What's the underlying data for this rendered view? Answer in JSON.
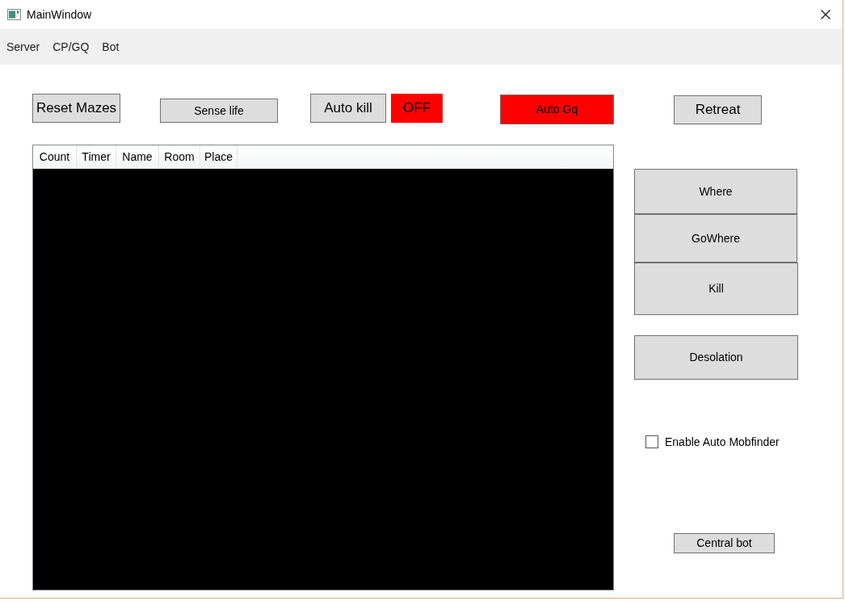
{
  "window": {
    "title": "MainWindow"
  },
  "menu": [
    "Server",
    "CP/GQ",
    "Bot"
  ],
  "toolbar": [
    {
      "kind": "button",
      "label": "Reset Mazes"
    },
    {
      "kind": "button",
      "label": "Sense life"
    },
    {
      "kind": "button",
      "label": "Auto kill"
    },
    {
      "kind": "status",
      "label": "OFF",
      "on": false
    },
    {
      "kind": "toggle",
      "label": "Auto Gq",
      "on": false
    },
    {
      "kind": "button",
      "label": "Retreat"
    }
  ],
  "table": {
    "columns": [
      "Count",
      "Timer",
      "Name",
      "Room",
      "Place"
    ]
  },
  "side_buttons": [
    "Where",
    "GoWhere",
    "Kill",
    "Desolation"
  ],
  "checkbox": {
    "label": "Enable Auto Mobfinder",
    "checked": false
  },
  "bottom_button": "Central bot"
}
